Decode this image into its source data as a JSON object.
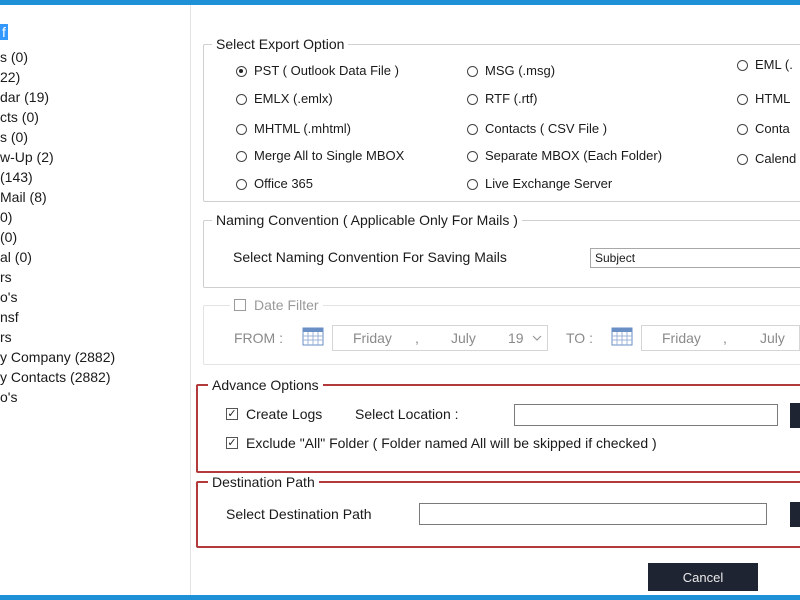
{
  "tree": {
    "items": [
      {
        "label": "f",
        "selected": true
      },
      {
        "label": "s (0)"
      },
      {
        "label": "22)"
      },
      {
        "label": "dar (19)"
      },
      {
        "label": "cts (0)"
      },
      {
        "label": "s (0)"
      },
      {
        "label": "w-Up (2)"
      },
      {
        "label": "(143)"
      },
      {
        "label": "Mail (8)"
      },
      {
        "label": "0)"
      },
      {
        "label": "(0)"
      },
      {
        "label": "al (0)"
      },
      {
        "label": "rs"
      },
      {
        "label": "o's"
      },
      {
        "label": "nsf"
      },
      {
        "label": "rs"
      },
      {
        "label": "y Company (2882)"
      },
      {
        "label": "y Contacts (2882)"
      },
      {
        "label": "o's"
      }
    ]
  },
  "export": {
    "legend": "Select Export Option",
    "options": [
      {
        "label": "PST ( Outlook Data File )",
        "checked": true
      },
      {
        "label": "MSG (.msg)"
      },
      {
        "label": "EML (."
      },
      {
        "label": "EMLX (.emlx)"
      },
      {
        "label": "RTF (.rtf)"
      },
      {
        "label": "HTML"
      },
      {
        "label": "MHTML (.mhtml)"
      },
      {
        "label": "Contacts ( CSV File )"
      },
      {
        "label": "Conta"
      },
      {
        "label": "Merge All to Single MBOX"
      },
      {
        "label": "Separate MBOX (Each Folder)"
      },
      {
        "label": "Calend"
      },
      {
        "label": "Office 365"
      },
      {
        "label": "Live Exchange Server"
      }
    ]
  },
  "naming": {
    "legend": "Naming Convention ( Applicable Only For Mails )",
    "label": "Select Naming Convention For Saving Mails",
    "value": "Subject"
  },
  "date_filter": {
    "label": "Date Filter",
    "from_label": "FROM :",
    "to_label": "TO :",
    "from": {
      "day": "Friday",
      "sep": ",",
      "month": "July",
      "date": "19"
    },
    "to": {
      "day": "Friday",
      "sep": ",",
      "month": "July"
    }
  },
  "advance": {
    "legend": "Advance Options",
    "create_logs": "Create Logs",
    "select_location": "Select Location :",
    "exclude_all": "Exclude \"All\" Folder ( Folder named All will be skipped if checked )"
  },
  "destination": {
    "legend": "Destination Path",
    "label": "Select Destination Path"
  },
  "buttons": {
    "cancel": "Cancel"
  },
  "colors": {
    "accent": "#1e90d6",
    "highlight": "#b23a3a",
    "button_dark": "#1f2433"
  }
}
